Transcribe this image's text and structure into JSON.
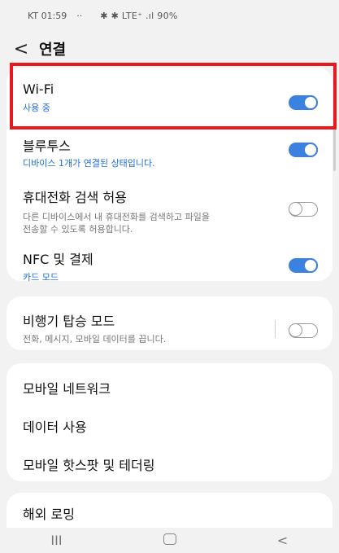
{
  "status_bar": {
    "carrier_time": "KT 01:59",
    "dots": "··",
    "indicators": "✱ ✱ LTE⁺ .ıl 90%"
  },
  "header": {
    "back_glyph": "<",
    "title": "연결"
  },
  "items": {
    "wifi": {
      "title": "Wi-Fi",
      "subtitle": "사용 중",
      "toggle": "on"
    },
    "bluetooth": {
      "title": "블루투스",
      "subtitle": "디바이스 1개가 연결된 상태입니다.",
      "toggle": "on"
    },
    "phone_visibility": {
      "title": "휴대전화 검색 허용",
      "subtitle_line1": "다른 디바이스에서 내 휴대전화를 검색하고 파일을",
      "subtitle_line2": "전송할 수 있도록 허용합니다.",
      "toggle": "off"
    },
    "nfc": {
      "title": "NFC 및 결제",
      "subtitle": "카드 모드",
      "toggle": "on"
    },
    "airplane": {
      "title": "비행기 탑승 모드",
      "subtitle": "전화, 메시지, 모바일 데이터를 끕니다.",
      "toggle": "off"
    },
    "mobile_network": {
      "title": "모바일 네트워크"
    },
    "data_usage": {
      "title": "데이터 사용"
    },
    "hotspot": {
      "title": "모바일 핫스팟 및 테더링"
    },
    "roaming": {
      "title": "해외 로밍"
    }
  },
  "nav": {
    "recents": "III",
    "home": "",
    "back": "<"
  },
  "colors": {
    "accent": "#3b82e0",
    "highlight": "#e8191c",
    "subtitle_blue": "#1f6fd4"
  }
}
